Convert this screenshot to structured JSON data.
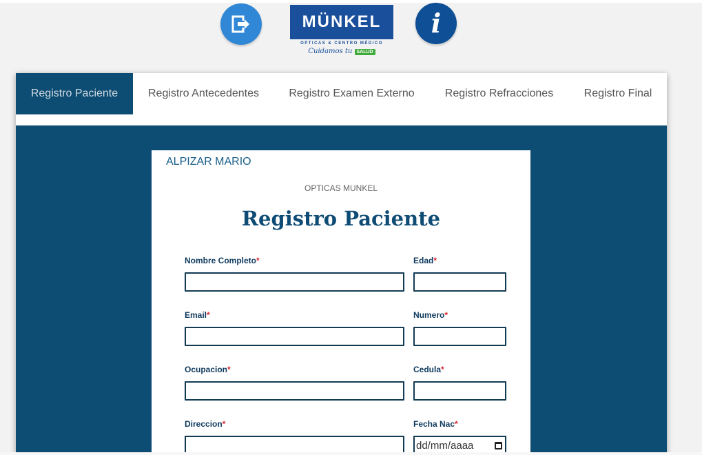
{
  "header": {
    "logo": {
      "brand": "MÜNKEL",
      "subtitle": "OPTICAS & CENTRO MÉDICO",
      "tagline": "Cuidamos tu",
      "tagline_badge": "SALUD"
    },
    "logout_icon": "logout-icon",
    "info_icon": "info-icon",
    "info_glyph": "i"
  },
  "tabs": [
    {
      "label": "Registro Paciente",
      "active": true
    },
    {
      "label": "Registro Antecedentes"
    },
    {
      "label": "Registro Examen Externo"
    },
    {
      "label": "Registro Refracciones"
    },
    {
      "label": "Registro Final"
    }
  ],
  "form": {
    "user_name": "ALPIZAR MARIO",
    "company": "OPTICAS MUNKEL",
    "title": "Registro Paciente",
    "required_mark": "*",
    "fields": {
      "nombre": {
        "label": "Nombre Completo",
        "value": ""
      },
      "edad": {
        "label": "Edad",
        "value": ""
      },
      "email": {
        "label": "Email",
        "value": ""
      },
      "numero": {
        "label": "Numero",
        "value": ""
      },
      "ocupacion": {
        "label": "Ocupacion",
        "value": ""
      },
      "cedula": {
        "label": "Cedula",
        "value": ""
      },
      "direccion": {
        "label": "Direccion",
        "value": ""
      },
      "fecha_nac": {
        "label": "Fecha Nac",
        "placeholder": "dd/mm/aaaa"
      }
    }
  },
  "colors": {
    "primary": "#0e4d73",
    "logo_blue": "#1a4f9c",
    "required": "#d9232d"
  }
}
